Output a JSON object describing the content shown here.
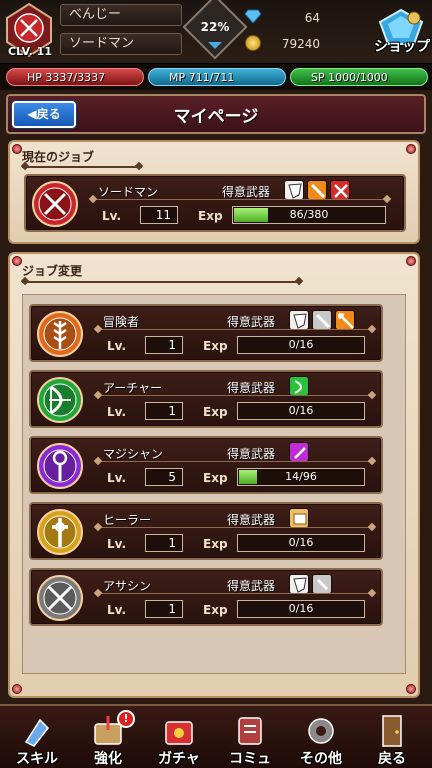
{
  "header": {
    "level_label": "CLV. 11",
    "player_name": "べんじー",
    "job_name": "ソードマン",
    "progress_percent": "22%",
    "gems": "64",
    "coins": "79240",
    "shop_label": "ショップ"
  },
  "stats": {
    "hp": "HP 3337/3337",
    "mp": "MP 711/711",
    "sp": "SP 1000/1000"
  },
  "page": {
    "back_label": "戻る",
    "title": "マイページ"
  },
  "current_job": {
    "section_title": "現在のジョブ",
    "name": "ソードマン",
    "weapon_label": "得意武器",
    "lv_label": "Lv.",
    "lv": "11",
    "exp_label": "Exp",
    "exp": "86/380",
    "exp_fraction": 0.226,
    "weapons": [
      "shield-icon",
      "sword-icon",
      "dual-sword-icon"
    ],
    "emblem": "sword-emblem-icon",
    "color": "#c8262b"
  },
  "job_change": {
    "section_title": "ジョブ変更",
    "jobs": [
      {
        "name": "冒険者",
        "weapon_label": "得意武器",
        "lv_label": "Lv.",
        "lv": "1",
        "exp_label": "Exp",
        "exp": "0/16",
        "exp_fraction": 0,
        "weapons": [
          "shield-icon",
          "sword-icon",
          "spear-icon"
        ],
        "emblem": "wheat-emblem-icon",
        "color": "#e06a1a"
      },
      {
        "name": "アーチャー",
        "weapon_label": "得意武器",
        "lv_label": "Lv.",
        "lv": "1",
        "exp_label": "Exp",
        "exp": "0/16",
        "exp_fraction": 0,
        "weapons": [
          "bow-icon"
        ],
        "emblem": "bow-emblem-icon",
        "color": "#22a83a"
      },
      {
        "name": "マジシャン",
        "weapon_label": "得意武器",
        "lv_label": "Lv.",
        "lv": "5",
        "exp_label": "Exp",
        "exp": "14/96",
        "exp_fraction": 0.146,
        "weapons": [
          "staff-icon"
        ],
        "emblem": "staff-emblem-icon",
        "color": "#8a2ad6"
      },
      {
        "name": "ヒーラー",
        "weapon_label": "得意武器",
        "lv_label": "Lv.",
        "lv": "1",
        "exp_label": "Exp",
        "exp": "0/16",
        "exp_fraction": 0,
        "weapons": [
          "book-icon"
        ],
        "emblem": "cross-emblem-icon",
        "color": "#d8a21a"
      },
      {
        "name": "アサシン",
        "weapon_label": "得意武器",
        "lv_label": "Lv.",
        "lv": "1",
        "exp_label": "Exp",
        "exp": "0/16",
        "exp_fraction": 0,
        "weapons": [
          "shield-icon",
          "dagger-icon"
        ],
        "emblem": "crossed-daggers-emblem-icon",
        "color": "#7a7a7a"
      }
    ]
  },
  "nav": [
    {
      "label": "スキル",
      "icon": "skill-icon"
    },
    {
      "label": "強化",
      "icon": "upgrade-icon",
      "badge": "!"
    },
    {
      "label": "ガチャ",
      "icon": "gacha-icon"
    },
    {
      "label": "コミュ",
      "icon": "community-icon"
    },
    {
      "label": "その他",
      "icon": "settings-icon"
    },
    {
      "label": "戻る",
      "icon": "door-icon"
    }
  ]
}
